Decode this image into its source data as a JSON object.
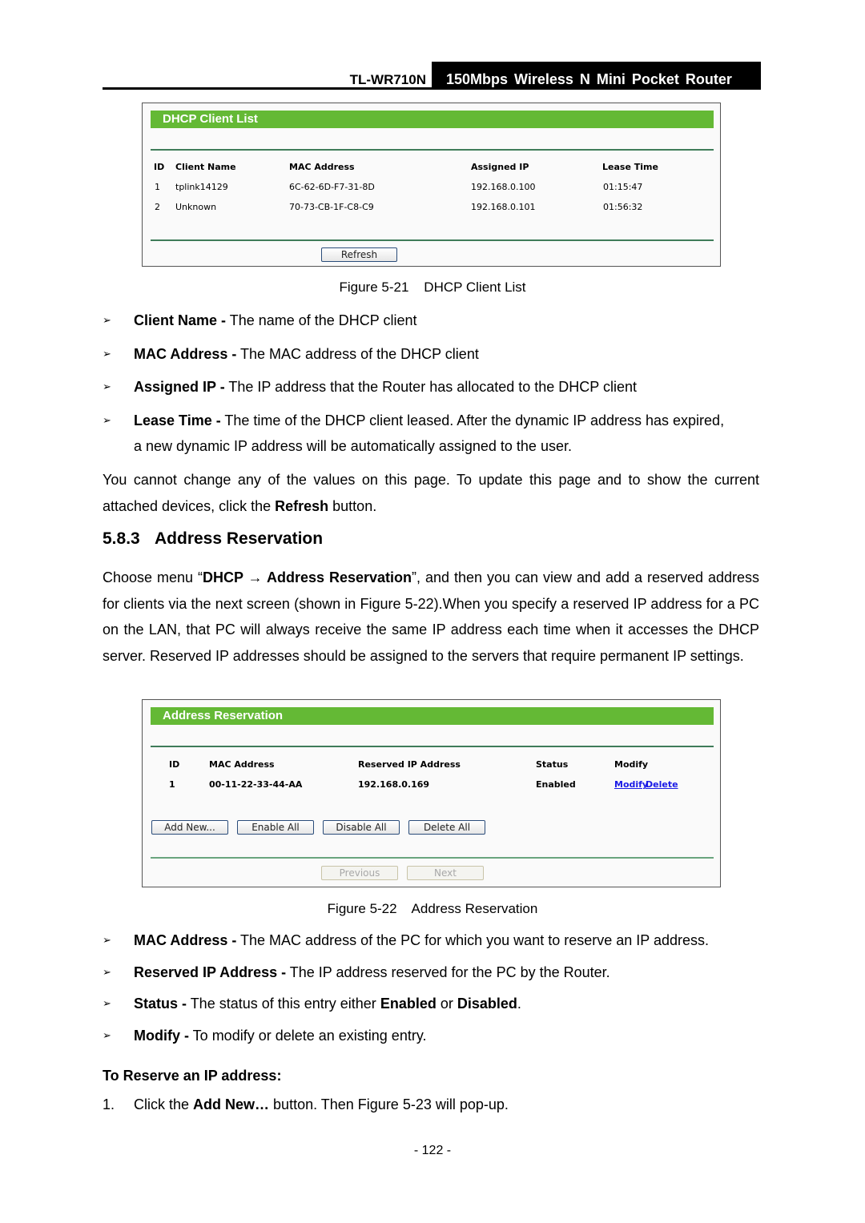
{
  "header": {
    "model": "TL-WR710N",
    "product": "150Mbps Wireless N Mini Pocket Router"
  },
  "dhcp_client_list": {
    "title": "DHCP Client List",
    "columns": [
      "ID",
      "Client Name",
      "MAC Address",
      "Assigned IP",
      "Lease Time"
    ],
    "rows": [
      [
        "1",
        "tplink14129",
        "6C-62-6D-F7-31-8D",
        "192.168.0.100",
        "01:15:47"
      ],
      [
        "2",
        "Unknown",
        "70-73-CB-1F-C8-C9",
        "192.168.0.101",
        "01:56:32"
      ]
    ],
    "refresh_label": "Refresh"
  },
  "figure_21_caption": "Figure 5-21    DHCP Client List",
  "dhcp_bullets": [
    {
      "term": "Client Name -",
      "text": " The name of the DHCP client"
    },
    {
      "term": "MAC Address -",
      "text": " The MAC address of the DHCP client"
    },
    {
      "term": "Assigned IP -",
      "text": " The IP address that the Router has allocated to the DHCP client"
    },
    {
      "term": "Lease Time -",
      "text": " The time of the DHCP client leased. After the dynamic IP address has expired,",
      "text2": "a new dynamic IP address will be automatically assigned to the user."
    }
  ],
  "refresh_para": {
    "part1": "You cannot change any of the values on this page. To update this page and to show the current attached devices, click the ",
    "bold": "Refresh",
    "part2": " button."
  },
  "section": {
    "number": "5.8.3",
    "title": "Address Reservation"
  },
  "intro_para": {
    "part1": "Choose menu “",
    "bold1": "DHCP → Address Reservation",
    "part2": "”, and then you can view and add a reserved address for clients via the next screen (shown in Figure 5-22).When you specify a reserved IP address for a PC on the LAN, that PC will always receive the same IP address each time when it accesses the DHCP server. Reserved IP addresses should be assigned to the servers that require permanent IP settings."
  },
  "address_reservation": {
    "title": "Address Reservation",
    "columns": [
      "ID",
      "MAC Address",
      "Reserved IP Address",
      "Status",
      "Modify"
    ],
    "rows": [
      {
        "id": "1",
        "mac": "00-11-22-33-44-AA",
        "ip": "192.168.0.169",
        "status": "Enabled",
        "modify": "Modify",
        "delete": "Delete"
      }
    ],
    "buttons": {
      "add_new": "Add New...",
      "enable_all": "Enable All",
      "disable_all": "Disable All",
      "delete_all": "Delete All",
      "previous": "Previous",
      "next": "Next"
    }
  },
  "figure_22_caption": "Figure 5-22    Address Reservation",
  "reservation_bullets": [
    {
      "term": "MAC Address -",
      "text": " The MAC address of the PC for which you want to reserve an IP address."
    },
    {
      "term": "Reserved IP Address -",
      "text": " The IP address reserved for the PC by the Router."
    },
    {
      "term": "Status -",
      "text": " The status of this entry either ",
      "bold2": "Enabled",
      "mid": " or ",
      "bold3": "Disabled",
      "end": "."
    },
    {
      "term": "Modify -",
      "text": " To modify or delete an existing entry."
    }
  ],
  "procedure": {
    "heading": "To Reserve an IP address:",
    "step1_num": "1.",
    "step1_a": "Click the ",
    "step1_bold": "Add New…",
    "step1_b": " button. Then Figure 5-23 will pop-up."
  },
  "icons": {
    "bullet": "➢"
  },
  "page_number": "- 122 -",
  "colors": {
    "panel_header": "#64b935",
    "panel_rule": "#3f7c59",
    "link": "#1a1ae6"
  }
}
